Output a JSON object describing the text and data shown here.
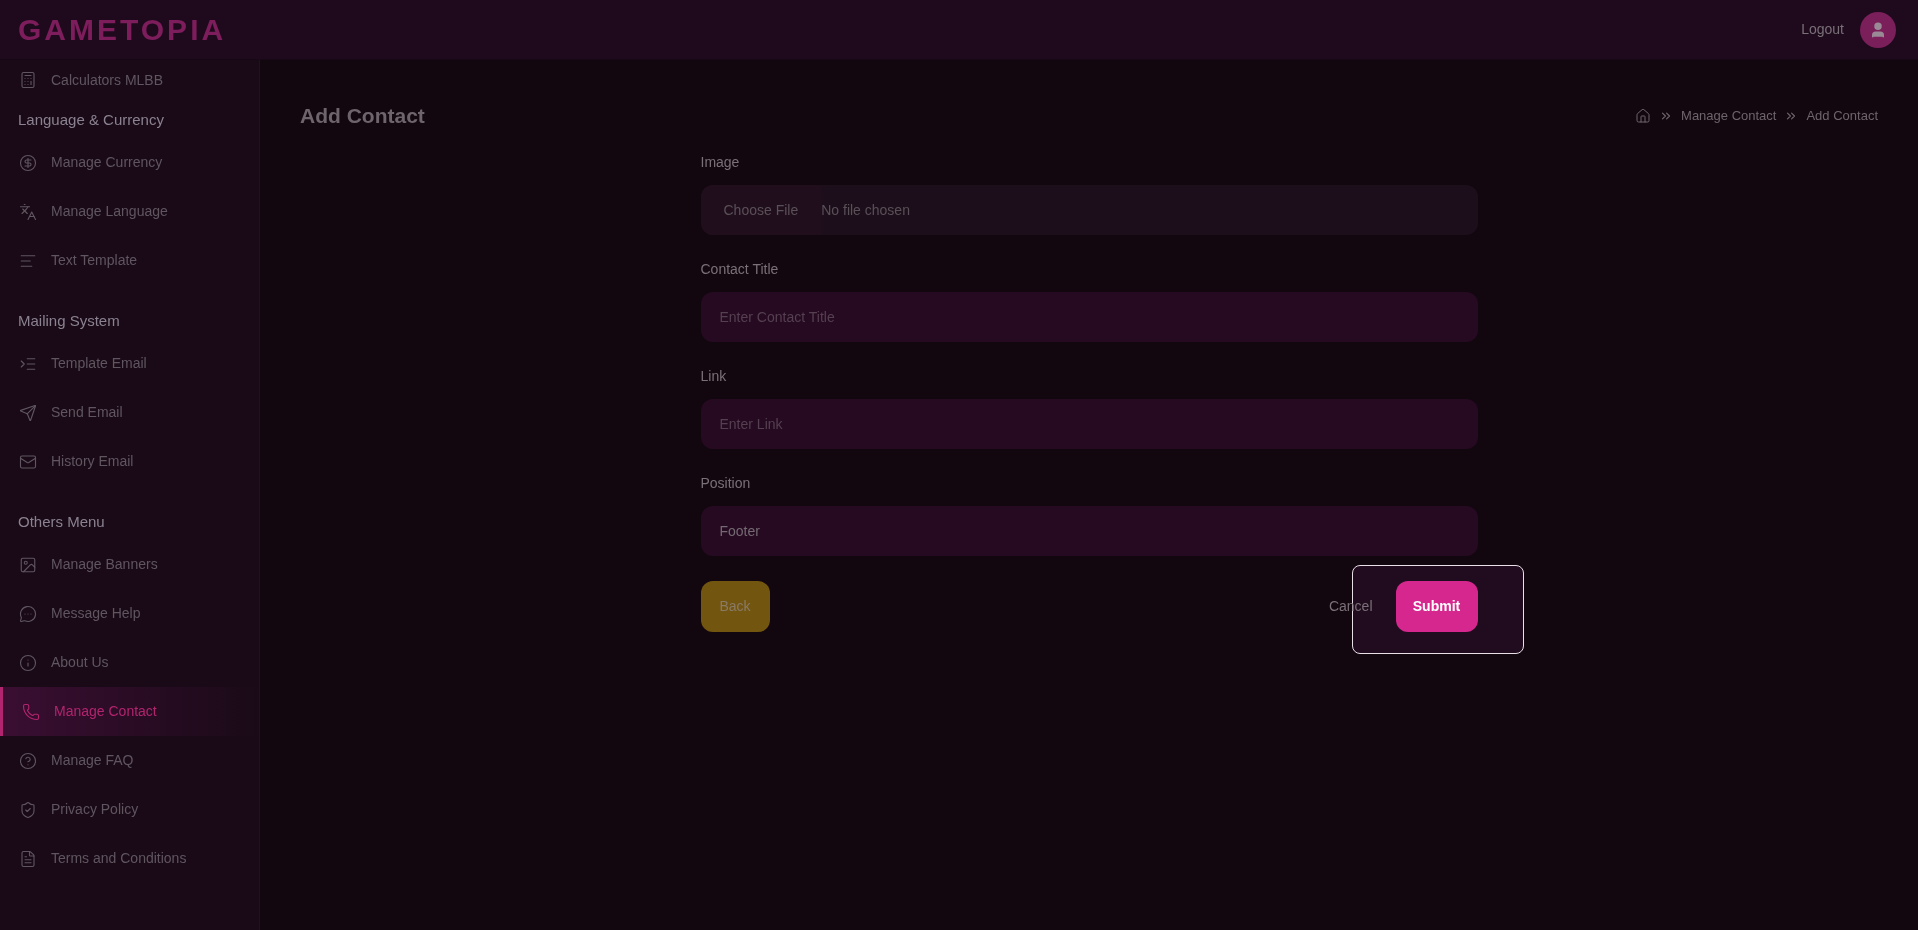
{
  "header": {
    "logo": "GAMETOPIA",
    "logout": "Logout"
  },
  "sidebar": {
    "items": [
      {
        "kind": "link",
        "label": "Calculators MLBB",
        "selected": false
      },
      {
        "kind": "heading",
        "label": "Language & Currency"
      },
      {
        "kind": "link",
        "label": "Manage Currency",
        "selected": false
      },
      {
        "kind": "link",
        "label": "Manage Language",
        "selected": false
      },
      {
        "kind": "link",
        "label": "Text Template",
        "selected": false
      },
      {
        "kind": "heading",
        "label": "Mailing System"
      },
      {
        "kind": "link",
        "label": "Template Email",
        "selected": false
      },
      {
        "kind": "link",
        "label": "Send Email",
        "selected": false
      },
      {
        "kind": "link",
        "label": "History Email",
        "selected": false
      },
      {
        "kind": "heading",
        "label": "Others Menu"
      },
      {
        "kind": "link",
        "label": "Manage Banners",
        "selected": false
      },
      {
        "kind": "link",
        "label": "Message Help",
        "selected": false
      },
      {
        "kind": "link",
        "label": "About Us",
        "selected": false
      },
      {
        "kind": "link",
        "label": "Manage Contact",
        "selected": true
      },
      {
        "kind": "link",
        "label": "Manage FAQ",
        "selected": false
      },
      {
        "kind": "link",
        "label": "Privacy Policy",
        "selected": false
      },
      {
        "kind": "link",
        "label": "Terms and Conditions",
        "selected": false
      }
    ]
  },
  "page": {
    "title": "Add Contact",
    "breadcrumb": [
      "Manage Contact",
      "Add Contact"
    ]
  },
  "form": {
    "fields": [
      {
        "kind": "file",
        "label": "Image",
        "button": "Choose File",
        "value": "No file chosen"
      },
      {
        "kind": "text",
        "label": "Contact Title",
        "placeholder": "Enter Contact Title"
      },
      {
        "kind": "text",
        "label": "Link",
        "placeholder": "Enter Link"
      },
      {
        "kind": "select",
        "label": "Position",
        "value": "Footer"
      }
    ],
    "buttons": {
      "back": "Back",
      "cancel": "Cancel",
      "submit": "Submit"
    }
  }
}
